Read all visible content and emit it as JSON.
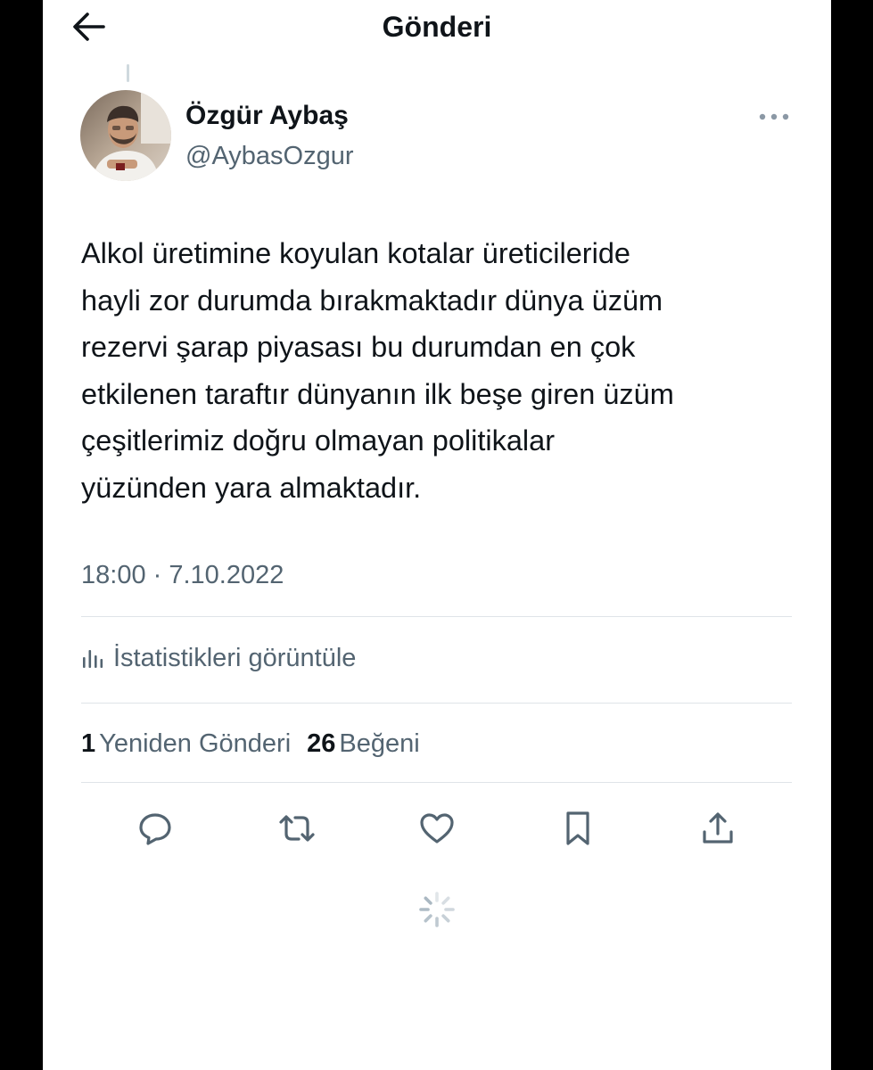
{
  "header": {
    "title": "Gönderi",
    "back_icon": "arrow-left-icon"
  },
  "author": {
    "name": "Özgür Aybaş",
    "handle": "@AybasOzgur"
  },
  "tweet": {
    "lines": [
      "Alkol üretimine koyulan kotalar üreticileride",
      "hayli zor durumda bırakmaktadır dünya üzüm",
      "rezervi şarap piyasası bu durumdan en çok",
      "etkilenen taraftır dünyanın ilk beşe giren üzüm",
      "çeşitlerimiz doğru olmayan politikalar",
      "yüzünden yara almaktadır."
    ],
    "timestamp": "18:00 · 7.10.2022"
  },
  "stats": {
    "view_label": "İstatistikleri görüntüle"
  },
  "counts": {
    "retweets_count": "1",
    "retweets_label": "Yeniden Gönderi",
    "likes_count": "26",
    "likes_label": "Beğeni"
  },
  "actions": {
    "icons": [
      "reply-icon",
      "retweet-icon",
      "like-icon",
      "bookmark-icon",
      "share-icon"
    ]
  },
  "colors": {
    "text_primary": "#0f1419",
    "text_secondary": "#536471",
    "divider": "#dfe4e8",
    "background": "#ffffff",
    "frame": "#000000"
  }
}
